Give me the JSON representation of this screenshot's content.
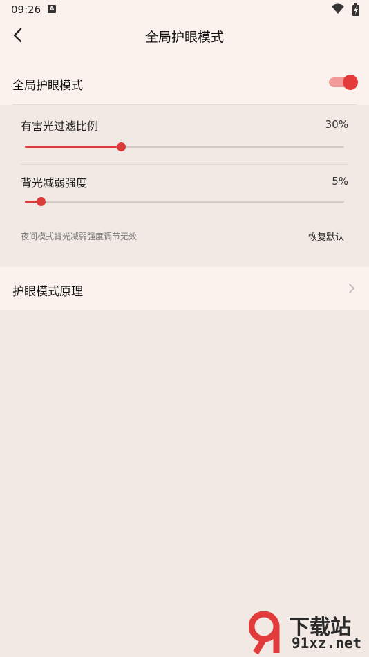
{
  "status": {
    "time": "09:26",
    "badge": "A"
  },
  "header": {
    "title": "全局护眼模式"
  },
  "main_toggle": {
    "label": "全局护眼模式",
    "on": true
  },
  "sliders": [
    {
      "label": "有害光过滤比例",
      "value_text": "30%",
      "value": 0.3
    },
    {
      "label": "背光减弱强度",
      "value_text": "5%",
      "value": 0.05
    }
  ],
  "note": "夜间模式背光减弱强度调节无效",
  "reset_label": "恢复默认",
  "principle_label": "护眼模式原理",
  "watermark": {
    "line1": "下载站",
    "line2": "91xz.net"
  },
  "colors": {
    "accent": "#dc3b3b",
    "toggle_track": "#f09a9a",
    "surface": "#fbf2ed",
    "background": "#f2e9e4"
  }
}
